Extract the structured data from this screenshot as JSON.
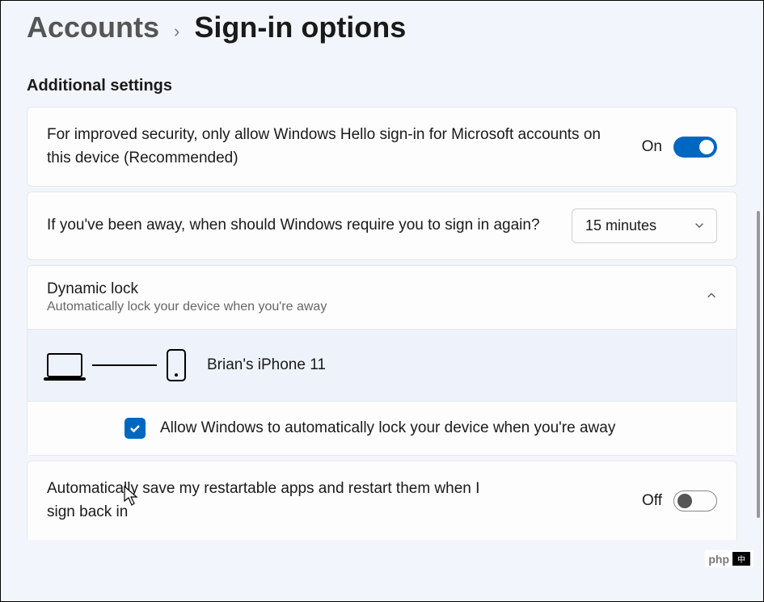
{
  "breadcrumb": {
    "parent": "Accounts",
    "current": "Sign-in options"
  },
  "section_title": "Additional settings",
  "hello_card": {
    "text": "For improved security, only allow Windows Hello sign-in for Microsoft accounts on this device (Recommended)",
    "state_label": "On"
  },
  "away_card": {
    "text": "If you've been away, when should Windows require you to sign in again?",
    "selected": "15 minutes"
  },
  "dynamic_lock": {
    "title": "Dynamic lock",
    "subtitle": "Automatically lock your device when you're away",
    "device_name": "Brian's iPhone 11",
    "checkbox_label": "Allow Windows to automatically lock your device when you're away"
  },
  "restart_apps": {
    "text": "Automatically save my restartable apps and restart them when I sign back in",
    "state_label": "Off"
  },
  "watermark": {
    "text1": "php",
    "text2": "中"
  }
}
